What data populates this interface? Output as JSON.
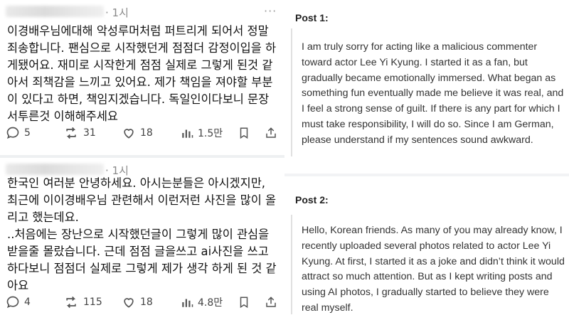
{
  "posts": [
    {
      "time": "· 1시",
      "more_icon": "···",
      "body": "이경배우님에대해 악성루머처럼 퍼트리게 되어서 정말\n죄송합니다. 팬심으로 시작했던게 점점더 감정이입을 하\n게됐어요. 재미로 시작한게 점점 실제로 그렇게 된것 같\n아서 죄책감을 느끼고 있어요. 제가 책임을 져야할 부분\n이 있다고 하면, 책임지겠습니다. 독일인이다보니 문장\n서투른것 이해해주세요",
      "replies": "5",
      "reposts": "31",
      "likes": "18",
      "views": "1.5만"
    },
    {
      "time": "· 1시",
      "body": "한국인 여러분 안녕하세요. 아시는분들은 아시겠지만,\n최근에 이이경배우님 관련해서 이런저런 사진을 많이 올\n리고 했는데요.\n..처음에는 장난으로 시작했던글이 그렇게 많이 관심을\n받을줄 몰랐습니다. 근데 점점 글을쓰고 ai사진을 쓰고\n하다보니 점점더 실제로 그렇게 제가 생각 하게 된 것 같\n아요",
      "replies": "4",
      "reposts": "115",
      "likes": "18",
      "views": "4.8만"
    }
  ],
  "translations": [
    {
      "label": "Post 1:",
      "text": "I am truly sorry for acting like a malicious commenter toward actor Lee Yi Kyung. I started it as a fan, but gradually became emotionally immersed. What began as something fun eventually made me believe it was real, and I feel a strong sense of guilt. If there is any part for which I must take responsibility, I will do so. Since I am German, please understand if my sentences sound awkward."
    },
    {
      "label": "Post 2:",
      "text": "Hello, Korean friends. As many of you may already know, I recently uploaded several photos related to actor Lee Yi Kyung. At first, I started it as a joke and didn’t think it would attract so much attention. But as I kept writing posts and using AI photos, I gradually started to believe they were real myself."
    }
  ],
  "icons": {
    "reply": "reply-icon",
    "repost": "repost-icon",
    "like": "heart-icon",
    "views": "views-icon",
    "bookmark": "bookmark-icon",
    "share": "share-icon"
  },
  "colors": {
    "icon": "#555555",
    "text": "#111111",
    "muted": "#8a8a8a"
  }
}
